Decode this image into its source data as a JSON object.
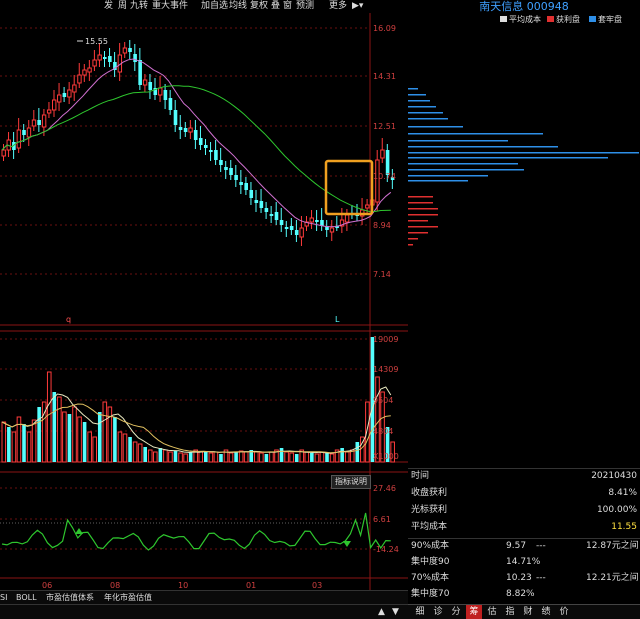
{
  "toolbar": {
    "items": [
      "发",
      "周",
      "九转",
      "重大事件",
      "加自选",
      "均线",
      "复权",
      "叠",
      "窗",
      "预测",
      "更多"
    ],
    "menu_icon": "arrow-dropdown-icon"
  },
  "price_axis": [
    "16.09",
    "14.31",
    "12.51",
    "10.74",
    "8.94",
    "7.14"
  ],
  "volume_axis": [
    "19009",
    "14309",
    "9504",
    "4804",
    "X1000"
  ],
  "indicator_axis": [
    "27.46",
    "6.61",
    "-14.24"
  ],
  "indicator_label": "指标说明",
  "date_axis": [
    "06",
    "08",
    "10",
    "01",
    "03"
  ],
  "high_marker": "15.55",
  "marker_q": "q",
  "marker_l": "L",
  "stock": {
    "name": "南天信息",
    "code": "000948"
  },
  "legend": {
    "avg": "平均成本",
    "profit": "获利盘",
    "trapped": "套牢盘"
  },
  "colors": {
    "up": "#ff3b3b",
    "down": "#54ffff",
    "ma_pink": "#d070d0",
    "ma_green": "#2ec62e",
    "highlight": "#f0a020",
    "profit_bar": "#e03030",
    "trapped_bar": "#2e8fe8"
  },
  "info": [
    {
      "label": "时间",
      "value": "20210430"
    },
    {
      "label": "收盘获利",
      "value": "8.41%"
    },
    {
      "label": "光标获利",
      "value": "100.00%"
    },
    {
      "label": "平均成本",
      "value": "11.55"
    }
  ],
  "stats": [
    {
      "label": "90%成本",
      "a": "9.57",
      "dash": "---",
      "b": "12.87元之间"
    },
    {
      "label": "集中度90",
      "a": "14.71%",
      "dash": "",
      "b": ""
    },
    {
      "label": "70%成本",
      "a": "10.23",
      "dash": "---",
      "b": "12.21元之间"
    },
    {
      "label": "集中度70",
      "a": "8.82%",
      "dash": "",
      "b": ""
    }
  ],
  "bottom_tabs": [
    "SI",
    "BOLL",
    "市盈估值体系",
    "年化市盈估值"
  ],
  "right_tabs": [
    "细",
    "诊",
    "分",
    "筹",
    "估",
    "指",
    "财",
    "绩",
    "价"
  ],
  "active_right_tab": "筹",
  "status_arrows": [
    "up-arrow-icon",
    "down-arrow-icon"
  ]
}
